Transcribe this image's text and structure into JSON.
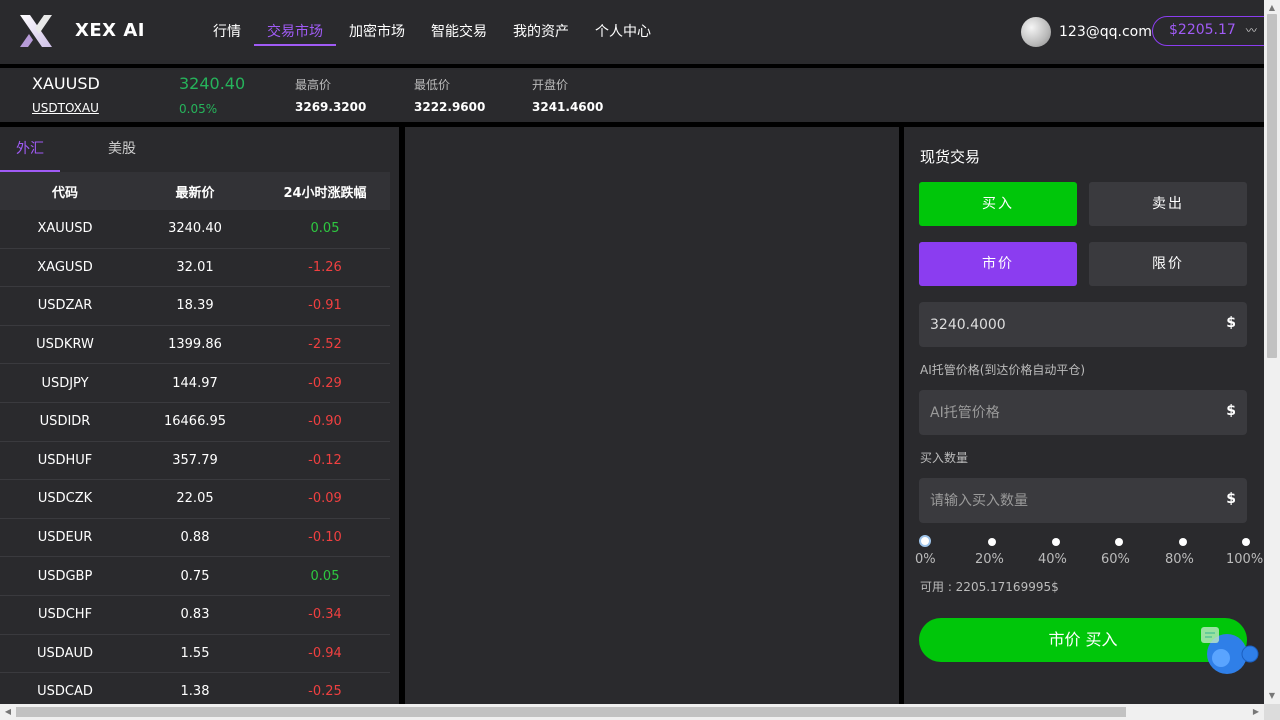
{
  "header": {
    "brand": "XEX AI",
    "nav": [
      "行情",
      "交易市场",
      "加密市场",
      "智能交易",
      "我的资产",
      "个人中心"
    ],
    "active_nav": 1,
    "user_email": "123@qq.com",
    "balance": "$2205.17",
    "balance_eye": "〰"
  },
  "ticker": {
    "symbol": "XAUUSD",
    "sub_link": "USDTOXAU",
    "price": "3240.40",
    "change": "0.05%",
    "high_label": "最高价",
    "high": "3269.3200",
    "low_label": "最低价",
    "low": "3222.9600",
    "open_label": "开盘价",
    "open": "3241.4600"
  },
  "market": {
    "tabs": [
      "外汇",
      "美股"
    ],
    "active_tab": 0,
    "columns": [
      "代码",
      "最新价",
      "24小时涨跌幅"
    ],
    "rows": [
      {
        "code": "XAUUSD",
        "price": "3240.40",
        "change": "0.05",
        "dir": "pos"
      },
      {
        "code": "XAGUSD",
        "price": "32.01",
        "change": "-1.26",
        "dir": "neg"
      },
      {
        "code": "USDZAR",
        "price": "18.39",
        "change": "-0.91",
        "dir": "neg"
      },
      {
        "code": "USDKRW",
        "price": "1399.86",
        "change": "-2.52",
        "dir": "neg"
      },
      {
        "code": "USDJPY",
        "price": "144.97",
        "change": "-0.29",
        "dir": "neg"
      },
      {
        "code": "USDIDR",
        "price": "16466.95",
        "change": "-0.90",
        "dir": "neg"
      },
      {
        "code": "USDHUF",
        "price": "357.79",
        "change": "-0.12",
        "dir": "neg"
      },
      {
        "code": "USDCZK",
        "price": "22.05",
        "change": "-0.09",
        "dir": "neg"
      },
      {
        "code": "USDEUR",
        "price": "0.88",
        "change": "-0.10",
        "dir": "neg"
      },
      {
        "code": "USDGBP",
        "price": "0.75",
        "change": "0.05",
        "dir": "pos"
      },
      {
        "code": "USDCHF",
        "price": "0.83",
        "change": "-0.34",
        "dir": "neg"
      },
      {
        "code": "USDAUD",
        "price": "1.55",
        "change": "-0.94",
        "dir": "neg"
      },
      {
        "code": "USDCAD",
        "price": "1.38",
        "change": "-0.25",
        "dir": "neg"
      }
    ]
  },
  "trade": {
    "title": "现货交易",
    "buy": "买入",
    "sell": "卖出",
    "market_order": "市价",
    "limit_order": "限价",
    "price_value": "3240.4000",
    "unit": "$",
    "ai_label": "AI托管价格(到达价格自动平仓)",
    "ai_placeholder": "AI托管价格",
    "qty_label": "买入数量",
    "qty_placeholder": "请输入买入数量",
    "percents": [
      "0%",
      "20%",
      "40%",
      "60%",
      "80%",
      "100%"
    ],
    "slider_value": 0,
    "available": "可用 : 2205.17169995$",
    "submit": "市价 买入"
  },
  "colors": {
    "accent": "#8b3df0",
    "buy_green": "#00c60a",
    "up": "#2ec840",
    "down": "#f04040"
  }
}
